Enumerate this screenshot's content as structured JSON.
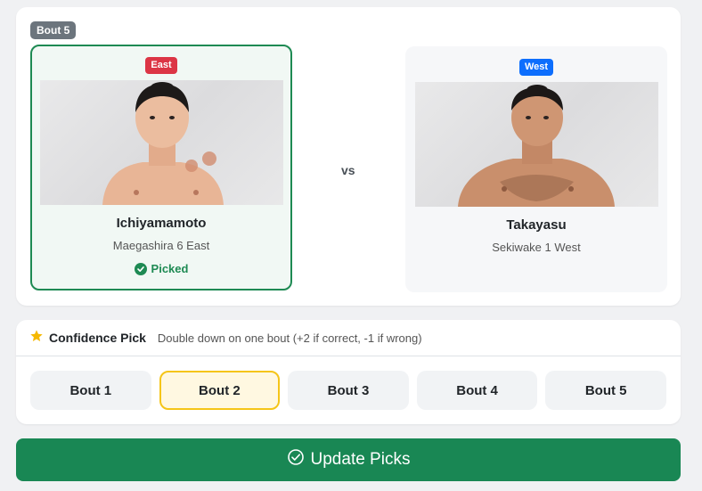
{
  "bout": {
    "tag": "Bout 5",
    "vs": "vs",
    "east": {
      "side": "East",
      "name": "Ichiyamamoto",
      "rank": "Maegashira 6 East",
      "picked_label": "Picked"
    },
    "west": {
      "side": "West",
      "name": "Takayasu",
      "rank": "Sekiwake 1 West"
    }
  },
  "confidence": {
    "title": "Confidence Pick",
    "description": "Double down on one bout (+2 if correct, -1 if wrong)",
    "icon": "star-icon",
    "options": [
      "Bout 1",
      "Bout 2",
      "Bout 3",
      "Bout 4",
      "Bout 5"
    ],
    "selected": "Bout 2"
  },
  "update": {
    "label": "Update Picks",
    "icon": "check-circle-icon"
  },
  "colors": {
    "east_badge": "#dc3545",
    "west_badge": "#0d6efd",
    "picked_green": "#1e8a53",
    "update_button": "#198754",
    "selected_border": "#f5c518"
  }
}
